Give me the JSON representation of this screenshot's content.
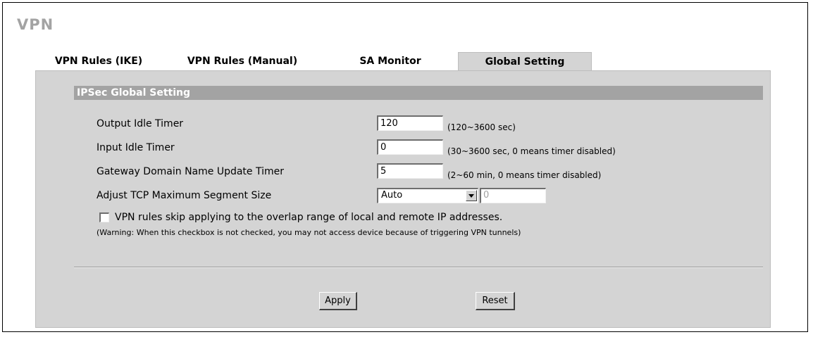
{
  "page": {
    "title": "VPN"
  },
  "tabs": [
    {
      "label": "VPN Rules (IKE)",
      "active": false
    },
    {
      "label": "VPN Rules (Manual)",
      "active": false
    },
    {
      "label": "SA Monitor",
      "active": false
    },
    {
      "label": "Global Setting",
      "active": true
    }
  ],
  "section": {
    "title": "IPSec Global Setting"
  },
  "fields": {
    "output_idle": {
      "label": "Output Idle Timer",
      "value": "120",
      "hint": "(120~3600 sec)"
    },
    "input_idle": {
      "label": "Input Idle Timer",
      "value": "0",
      "hint": "(30~3600 sec, 0 means timer disabled)"
    },
    "gateway_update": {
      "label": "Gateway Domain Name Update Timer",
      "value": "5",
      "hint": "(2~60 min, 0 means timer disabled)"
    },
    "tcp_mss": {
      "label": "Adjust TCP Maximum Segment Size",
      "selected": "Auto",
      "value": "0"
    }
  },
  "overlap_checkbox": {
    "label": "VPN rules skip applying to the overlap range of local and remote IP addresses.",
    "checked": false,
    "warning": "(Warning: When this checkbox is not checked, you may not access device because of triggering VPN tunnels)"
  },
  "buttons": {
    "apply": "Apply",
    "reset": "Reset"
  },
  "colors": {
    "panel_bg": "#d4d4d4",
    "section_header_bg": "#a3a3a3",
    "title_color": "#a3a3a3"
  }
}
